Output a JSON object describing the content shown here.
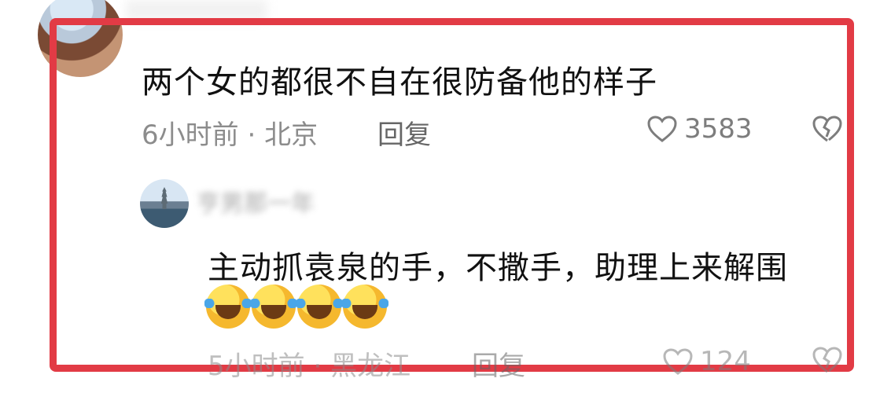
{
  "comment": {
    "text": "两个女的都很不自在很防备他的样子",
    "time": "6小时前",
    "separator": "·",
    "location": "北京",
    "reply_label": "回复",
    "likes": "3583",
    "avatar_icon": "user-avatar-icon"
  },
  "reply": {
    "username": "亨男那一年",
    "text": "主动抓袁泉的手，不撒手，助理上来解围",
    "emoji_name": "laughing-crying-emoji",
    "emoji_count": 4,
    "time": "5小时前",
    "separator": "·",
    "location": "黑龙江",
    "reply_label": "回复",
    "likes": "124"
  },
  "colors": {
    "highlight_frame": "#e23b45",
    "text": "#111111",
    "meta": "#8c8c8c"
  }
}
